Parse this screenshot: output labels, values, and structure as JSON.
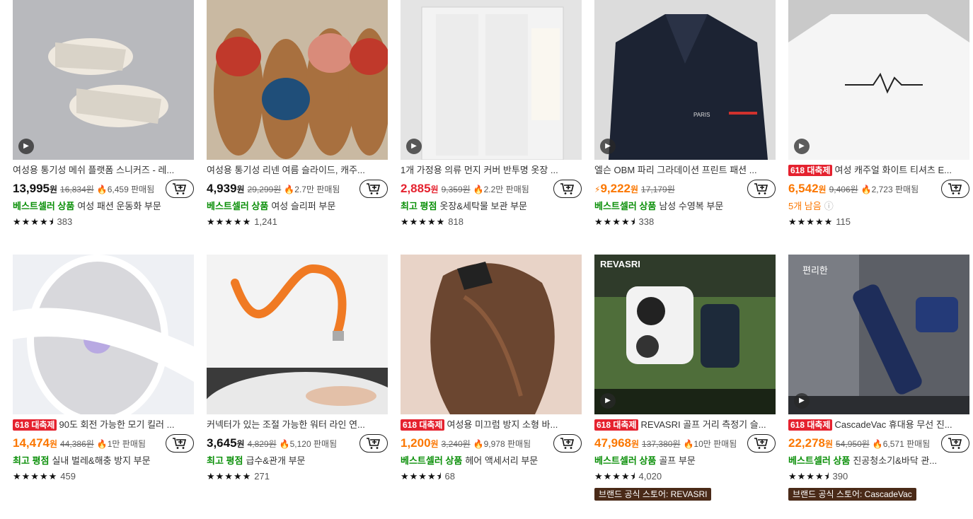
{
  "colors": {
    "red": "#e5222f",
    "orange": "#fb7701",
    "green": "#0a8f08",
    "brand_bg": "#4a2a18"
  },
  "products": [
    {
      "title": "여성용 통기성 메쉬 플랫폼 스니커즈 - 레...",
      "badge": "",
      "price": "13,995",
      "currency": "원",
      "orig": "16,834원",
      "sold": "6,459 판매됨",
      "hl": "베스트셀러 상품",
      "cat": "여성 패션 운동화 부문",
      "reviews": "383",
      "stars": "★★★★⯨"
    },
    {
      "title": "여성용 통기성 리넨 여름 슬라이드, 캐주...",
      "badge": "",
      "price": "4,939",
      "currency": "원",
      "orig": "29,299원",
      "sold": "2.7만 판매됨",
      "hl": "베스트셀러 상품",
      "cat": "여성 슬리퍼 부문",
      "reviews": "1,241",
      "stars": "★★★★★"
    },
    {
      "title": "1개 가정용 의류 먼지 커버 반투명 옷장 ...",
      "badge": "",
      "price": "2,885",
      "currency": "원",
      "orig": "9,359원",
      "sold": "2.2만 판매됨",
      "hl": "최고 평점",
      "cat": "옷장&세탁물 보관 부문",
      "reviews": "818",
      "stars": "★★★★★"
    },
    {
      "title": "엘슨 OBM 파리 그라데이션 프린트 패션 ...",
      "badge": "",
      "price": "9,222",
      "currency": "원",
      "orig": "17,179원",
      "sold": "",
      "hl": "베스트셀러 상품",
      "cat": "남성 수영복 부문",
      "reviews": "338",
      "stars": "★★★★⯨"
    },
    {
      "title": "여성 캐주얼 화이트 티셔츠 E...",
      "badge": "618 대축제",
      "price": "6,542",
      "currency": "원",
      "orig": "9,406원",
      "sold": "2,723 판매됨",
      "hl": "5개 남음",
      "cat": "",
      "reviews": "115",
      "stars": "★★★★★"
    },
    {
      "title": "90도 회전 가능한 모기 킬러 ...",
      "badge": "618 대축제",
      "price": "14,474",
      "currency": "원",
      "orig": "44,386원",
      "sold": "1만 판매됨",
      "hl": "최고 평점",
      "cat": "실내 벌레&해충 방지 부문",
      "reviews": "459",
      "stars": "★★★★★"
    },
    {
      "title": "커넥터가 있는 조절 가능한 워터 라인 연...",
      "badge": "",
      "price": "3,645",
      "currency": "원",
      "orig": "4,829원",
      "sold": "5,120 판매됨",
      "hl": "최고 평점",
      "cat": "급수&관개 부문",
      "reviews": "271",
      "stars": "★★★★★"
    },
    {
      "title": "여성용 미끄럼 방지 소형 바...",
      "badge": "618 대축제",
      "price": "1,200",
      "currency": "원",
      "orig": "3,240원",
      "sold": "9,978 판매됨",
      "hl": "베스트셀러 상품",
      "cat": "헤어 액세서리 부문",
      "reviews": "68",
      "stars": "★★★★⯨"
    },
    {
      "title": "REVASRI 골프 거리 측정기 슬...",
      "badge": "618 대축제",
      "price": "47,968",
      "currency": "원",
      "orig": "137,380원",
      "sold": "10만 판매됨",
      "hl": "베스트셀러 상품",
      "cat": "골프 부문",
      "reviews": "4,020",
      "stars": "★★★★⯨",
      "brand": "브랜드 공식 스토어: REVASRI"
    },
    {
      "title": "CascadeVac 휴대용 무선 진...",
      "badge": "618 대축제",
      "price": "22,278",
      "currency": "원",
      "orig": "54,950원",
      "sold": "6,571 판매됨",
      "hl": "베스트셀러 상품",
      "cat": "진공청소기&바닥 관...",
      "reviews": "390",
      "stars": "★★★★⯨",
      "brand": "브랜드 공식 스토어: CascadeVac"
    }
  ],
  "image_text": {
    "tshirt_brand": "PARIS",
    "revasri_logo": "REVASRI",
    "vac_label": "편리한"
  },
  "icons": {
    "play": "play-icon",
    "cart": "add-to-cart-icon",
    "flame": "flame-icon",
    "lightning": "lightning-icon"
  }
}
